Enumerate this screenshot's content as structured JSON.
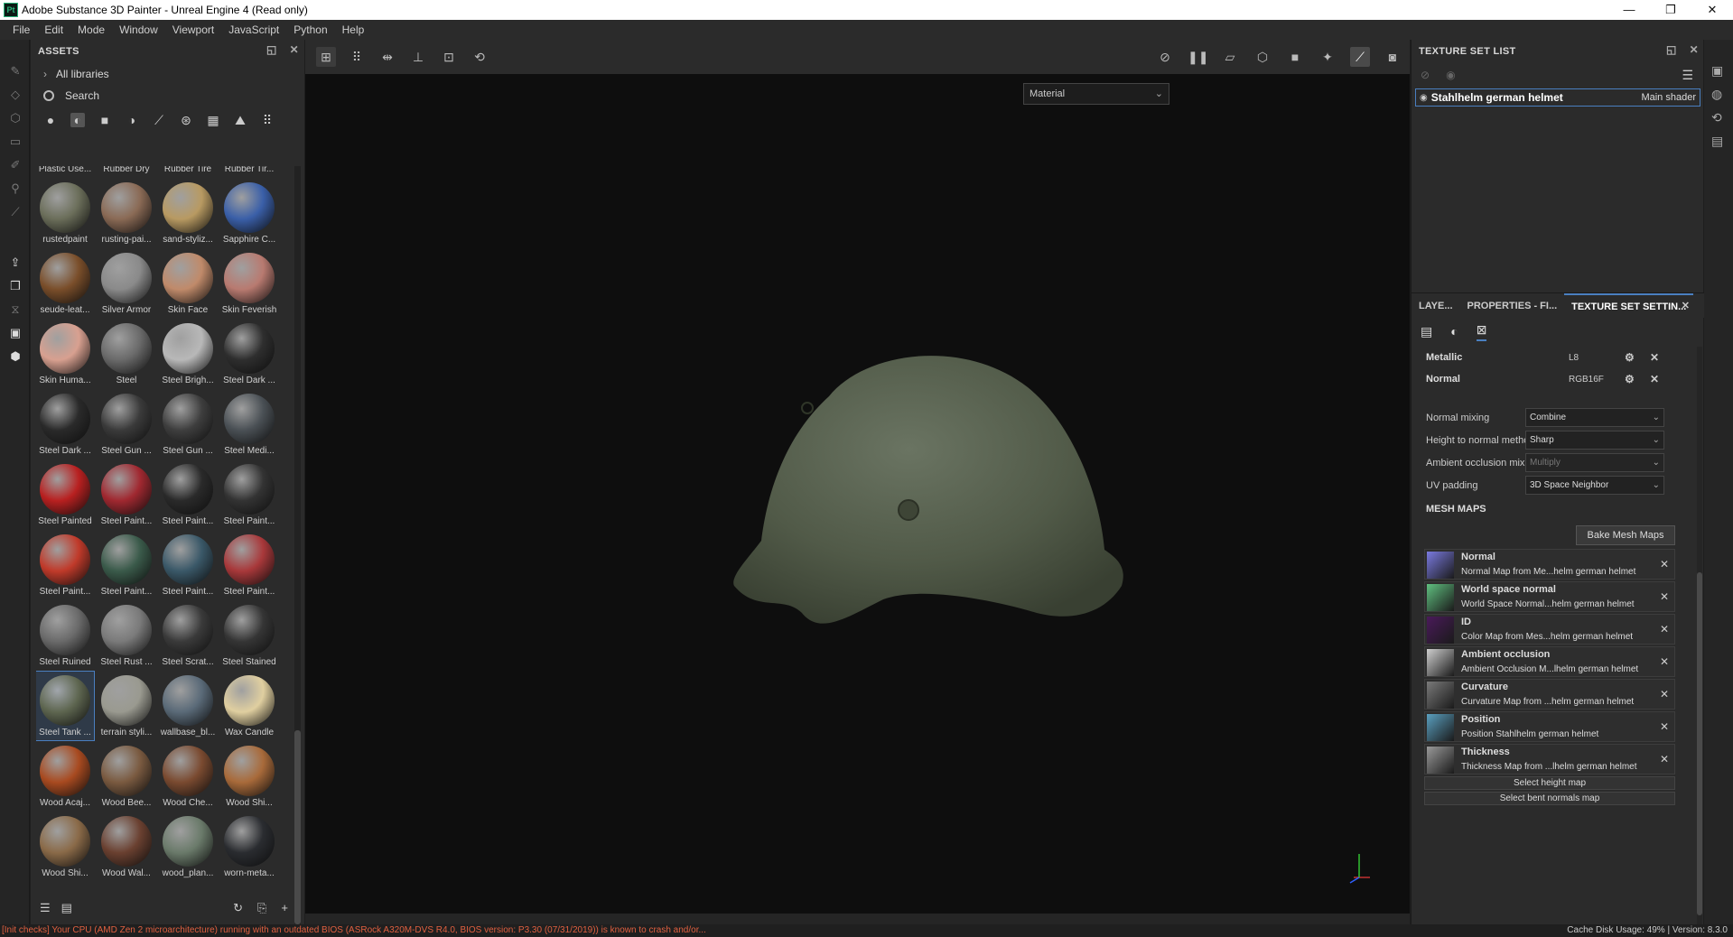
{
  "window": {
    "title": "Adobe Substance 3D Painter - Unreal Engine 4 (Read only)",
    "controls": [
      "—",
      "❐",
      "✕"
    ]
  },
  "menu": [
    "File",
    "Edit",
    "Mode",
    "Window",
    "Viewport",
    "JavaScript",
    "Python",
    "Help"
  ],
  "assets": {
    "title": "ASSETS",
    "libraries_label": "All libraries",
    "search_placeholder": "Search",
    "items": [
      {
        "label": "Plastic Use...",
        "color": "#8a7e6e"
      },
      {
        "label": "Rubber Dry",
        "color": "#3a3a3a"
      },
      {
        "label": "Rubber Tire",
        "color": "#2e2e2e"
      },
      {
        "label": "Rubber Tir...",
        "color": "#333333"
      },
      {
        "label": "rustedpaint",
        "color": "#6b6e5a"
      },
      {
        "label": "rusting-pai...",
        "color": "#8a6a55"
      },
      {
        "label": "sand-styliz...",
        "color": "#b89a62"
      },
      {
        "label": "Sapphire C...",
        "color": "#3a5fa8"
      },
      {
        "label": "seude-leat...",
        "color": "#7a4e2a"
      },
      {
        "label": "Silver Armor",
        "color": "#8a8a8a"
      },
      {
        "label": "Skin Face",
        "color": "#c08a6a"
      },
      {
        "label": "Skin Feverish",
        "color": "#b87a70"
      },
      {
        "label": "Skin Huma...",
        "color": "#d8a090"
      },
      {
        "label": "Steel",
        "color": "#6a6a6a"
      },
      {
        "label": "Steel Brigh...",
        "color": "#b8b8b8"
      },
      {
        "label": "Steel Dark ...",
        "color": "#2e2e2e"
      },
      {
        "label": "Steel Dark ...",
        "color": "#2a2a2a"
      },
      {
        "label": "Steel Gun ...",
        "color": "#3a3a3a"
      },
      {
        "label": "Steel Gun ...",
        "color": "#3e3e3e"
      },
      {
        "label": "Steel Medi...",
        "color": "#4a5055"
      },
      {
        "label": "Steel Painted",
        "color": "#b82020"
      },
      {
        "label": "Steel Paint...",
        "color": "#a02830"
      },
      {
        "label": "Steel Paint...",
        "color": "#2a2a2a"
      },
      {
        "label": "Steel Paint...",
        "color": "#333333"
      },
      {
        "label": "Steel Paint...",
        "color": "#c03a2a"
      },
      {
        "label": "Steel Paint...",
        "color": "#3a5a4a"
      },
      {
        "label": "Steel Paint...",
        "color": "#3a5868"
      },
      {
        "label": "Steel Paint...",
        "color": "#a8383a"
      },
      {
        "label": "Steel Ruined",
        "color": "#6a6a6a"
      },
      {
        "label": "Steel Rust ...",
        "color": "#7a7a7a"
      },
      {
        "label": "Steel Scrat...",
        "color": "#3a3a3a"
      },
      {
        "label": "Steel Stained",
        "color": "#353535"
      },
      {
        "label": "Steel Tank ...",
        "color": "#5e6650"
      },
      {
        "label": "terrain styli...",
        "color": "#9a9a90"
      },
      {
        "label": "wallbase_bl...",
        "color": "#5a6a78"
      },
      {
        "label": "Wax Candle",
        "color": "#e0cfa0"
      },
      {
        "label": "Wood Acaj...",
        "color": "#a84a20"
      },
      {
        "label": "Wood Bee...",
        "color": "#7a5a40"
      },
      {
        "label": "Wood Che...",
        "color": "#7a4a30"
      },
      {
        "label": "Wood Shi...",
        "color": "#a86a3a"
      },
      {
        "label": "Wood Shi...",
        "color": "#8a6a48"
      },
      {
        "label": "Wood Wal...",
        "color": "#6a4030"
      },
      {
        "label": "wood_plan...",
        "color": "#6a7a6a"
      },
      {
        "label": "worn-meta...",
        "color": "#2a2c30"
      }
    ],
    "selected_index": 32
  },
  "viewport": {
    "material_dropdown": "Material"
  },
  "texture_set_list": {
    "title": "TEXTURE SET LIST",
    "item_name": "Stahlhelm german helmet",
    "item_shader": "Main shader"
  },
  "tabs": {
    "layers": "LAYE...",
    "properties": "PROPERTIES - FI...",
    "texture_set_settings": "TEXTURE SET SETTIN..."
  },
  "channels": [
    {
      "name": "Metallic",
      "format": "L8"
    },
    {
      "name": "Normal",
      "format": "RGB16F"
    }
  ],
  "settings": [
    {
      "label": "Normal mixing",
      "value": "Combine",
      "disabled": false
    },
    {
      "label": "Height to normal method",
      "value": "Sharp",
      "disabled": false
    },
    {
      "label": "Ambient occlusion mixing",
      "value": "Multiply",
      "disabled": true
    },
    {
      "label": "UV padding",
      "value": "3D Space Neighbor",
      "disabled": false
    }
  ],
  "mesh_maps": {
    "title": "MESH MAPS",
    "bake_button": "Bake Mesh Maps",
    "items": [
      {
        "name": "Normal",
        "desc": "Normal Map from Me...helm german helmet",
        "color": "#7a7ae0"
      },
      {
        "name": "World space normal",
        "desc": "World Space Normal...helm german helmet",
        "color": "#60c080"
      },
      {
        "name": "ID",
        "desc": "Color Map from Mes...helm german helmet",
        "color": "#4a1a5a"
      },
      {
        "name": "Ambient occlusion",
        "desc": "Ambient Occlusion M...lhelm german helmet",
        "color": "#cfcfcf"
      },
      {
        "name": "Curvature",
        "desc": "Curvature Map from ...helm german helmet",
        "color": "#7a7a7a"
      },
      {
        "name": "Position",
        "desc": "Position Stahlhelm german helmet",
        "color": "#5aa0c0"
      },
      {
        "name": "Thickness",
        "desc": "Thickness Map from ...lhelm german helmet",
        "color": "#9a9a9a"
      }
    ],
    "select_height": "Select height map",
    "select_bent": "Select bent normals map"
  },
  "status": {
    "warning": "[Init checks] Your CPU (AMD Zen 2 microarchitecture) running with an outdated BIOS (ASRock A320M-DVS R4.0, BIOS version: P3.30 (07/31/2019)) is known to crash and/or...",
    "right": "Cache Disk Usage:   49% | Version: 8.3.0"
  }
}
